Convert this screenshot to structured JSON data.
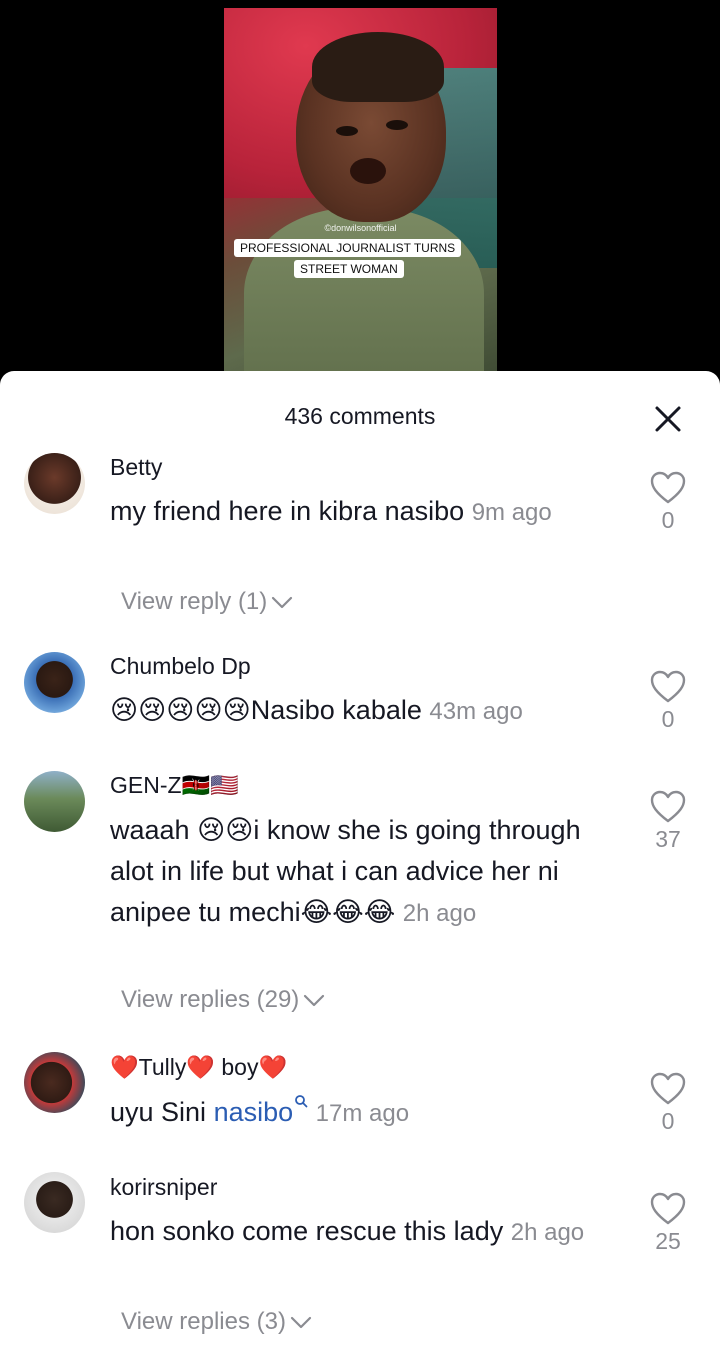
{
  "video": {
    "watermark": "©donwilsonofficial",
    "caption_line1": "PROFESSIONAL JOURNALIST TURNS",
    "caption_line2": "STREET WOMAN"
  },
  "sheet": {
    "comment_count_label": "436 comments"
  },
  "comments": [
    {
      "username": "Betty",
      "text": "my friend here in kibra nasibo",
      "time": "9m ago",
      "likes": "0",
      "replies_label": "View reply (1)"
    },
    {
      "username": "Chumbelo Dp",
      "emoji": "😢😢😢😢😢",
      "text": "Nasibo kabale",
      "time": "43m ago",
      "likes": "0"
    },
    {
      "username": "GEN-Z🇰🇪🇺🇸",
      "text_part1": "waaah ",
      "emoji1": "😢😢",
      "text_part2": "i know she is going through alot in life but what i can advice her ni anipee tu mechi",
      "emoji2": "😂😂😂",
      "time": "2h ago",
      "likes": "37",
      "replies_label": "View replies (29)"
    },
    {
      "username": "❤️Tully❤️ boy❤️",
      "text": "uyu Sini ",
      "link": "nasibo",
      "time": "17m ago",
      "likes": "0"
    },
    {
      "username": "korirsniper",
      "text": "hon sonko come rescue this lady",
      "time": "2h ago",
      "likes": "25",
      "replies_label": "View replies (3)"
    }
  ],
  "icons": {
    "close": "close-icon",
    "like": "heart-outline-icon",
    "expand": "chevron-down-icon",
    "search": "search-icon"
  },
  "colors": {
    "text_primary": "#161823",
    "text_secondary": "#8a8b91",
    "link": "#2b5db3"
  }
}
